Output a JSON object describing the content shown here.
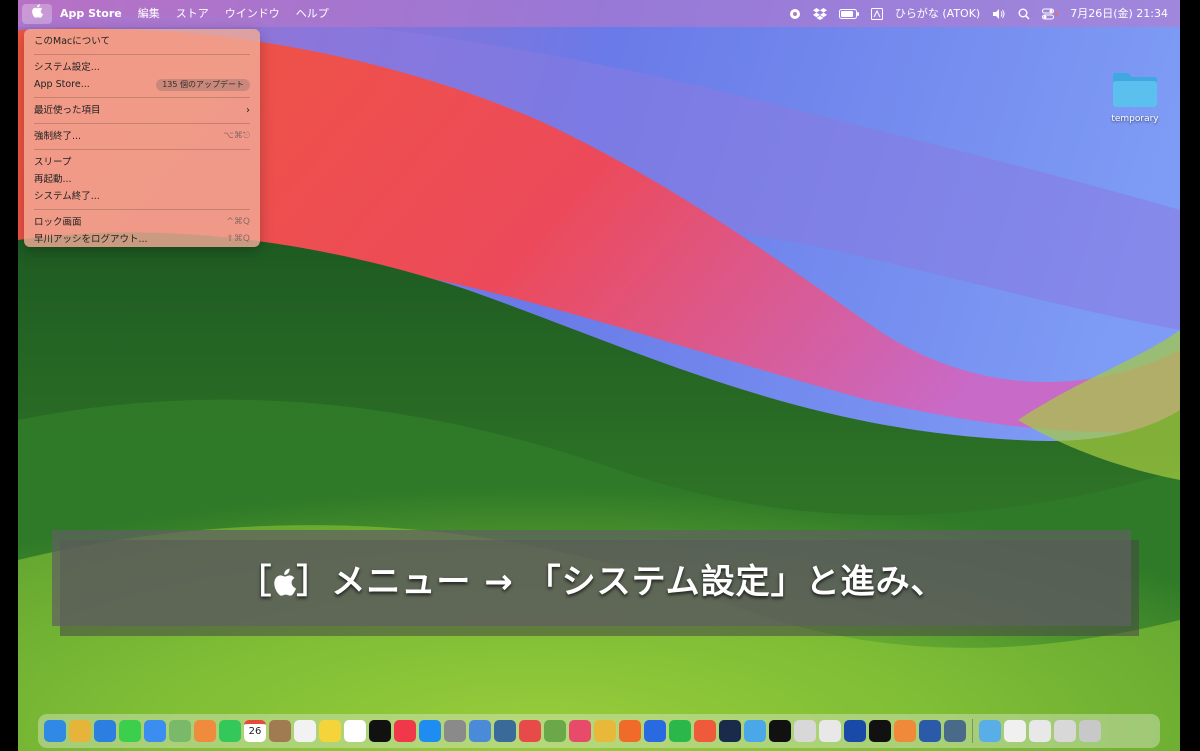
{
  "menubar": {
    "apple_icon": "apple-logo-icon",
    "app_name": "App Store",
    "menus": [
      "編集",
      "ストア",
      "ウインドウ",
      "ヘルプ"
    ],
    "input_method": "ひらがな (ATOK)",
    "datetime": "7月26日(金) 21:34"
  },
  "apple_menu": {
    "about": "このMacについて",
    "system_settings": "システム設定...",
    "app_store": "App Store...",
    "app_store_badge": "135 個のアップデート",
    "recent_items": "最近使った項目",
    "force_quit": "強制終了...",
    "force_quit_shortcut": "⌥⌘⎋",
    "sleep": "スリープ",
    "restart": "再起動...",
    "shutdown": "システム終了...",
    "lock_screen": "ロック画面",
    "lock_screen_shortcut": "^⌘Q",
    "logout": "早川アッシをログアウト...",
    "logout_shortcut": "⇧⌘Q"
  },
  "desktop": {
    "folder_label": "temporary"
  },
  "caption": {
    "text": "［］メニュー → 「システム設定」と進み、"
  },
  "dock": {
    "calendar_day": "26",
    "icons": [
      "finder-icon",
      "launchpad-icon",
      "safari-icon",
      "messages-icon",
      "mail-icon",
      "maps-icon",
      "photos-icon",
      "facetime-icon",
      "calendar-icon",
      "contacts-icon",
      "reminders-icon",
      "notes-icon",
      "freeform-icon",
      "tv-icon",
      "music-icon",
      "app-store-icon",
      "system-settings-icon",
      "preview-icon",
      "photo-app-icon",
      "airmail-icon",
      "tool-icon",
      "pin-icon",
      "chrome-icon",
      "firefox-icon",
      "xcode-icon",
      "line-icon",
      "vectornator-icon",
      "code-icon",
      "maps2-icon",
      "xit-icon",
      "clipboard-icon",
      "pencil-icon",
      "hand-icon",
      "cube-icon",
      "app1-icon",
      "app2-icon",
      "app3-icon",
      "folder-icon",
      "window1-icon",
      "window2-icon",
      "window3-icon",
      "trash-icon"
    ],
    "colors": [
      "#2f8ae6",
      "#e6b43a",
      "#2a7fe0",
      "#3ccf4e",
      "#3b8ef0",
      "#7ab86a",
      "#f08a3c",
      "#34c759",
      "#ffffff",
      "#a07a50",
      "#f2f2f2",
      "#f5d33a",
      "#ffffff",
      "#111111",
      "#f0384a",
      "#1e8cf0",
      "#8a8a8a",
      "#4a8ad8",
      "#3a6a9a",
      "#e84a4a",
      "#6aa84a",
      "#e84a6a",
      "#e8b83a",
      "#f06a2a",
      "#2a6ae0",
      "#2ab84a",
      "#ee5a3a",
      "#1a2a4a",
      "#4aa8e8",
      "#111111",
      "#d8d8d8",
      "#e8e8e8",
      "#1a4aa8",
      "#111111",
      "#f08a3a",
      "#2a5aa8",
      "#4a6a8a",
      "#5aaee8",
      "#f0f0f0",
      "#e8e8e8",
      "#d8d8d8",
      "#c8c8c8"
    ]
  }
}
